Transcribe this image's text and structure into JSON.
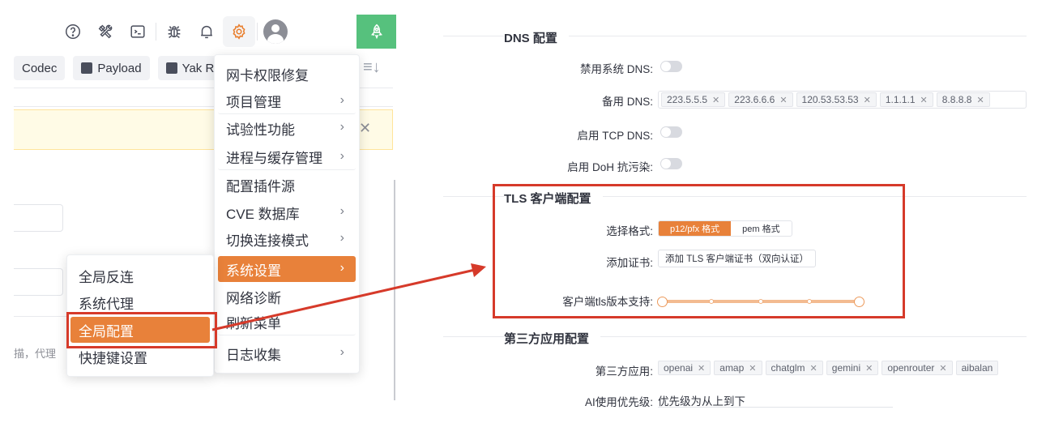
{
  "toolbar": {
    "icons": [
      "help-icon",
      "tools-icon",
      "terminal-icon",
      "bug-icon",
      "bell-icon",
      "gear-icon",
      "user-avatar",
      "rocket-icon"
    ],
    "active_icon": "gear-icon"
  },
  "tabs": [
    {
      "label": "Codec"
    },
    {
      "label": "Payload"
    },
    {
      "label": "Yak R"
    }
  ],
  "partial_text": "描，代理",
  "main_menu": {
    "items": [
      {
        "label": "网卡权限修复",
        "submenu": false
      },
      {
        "label": "项目管理",
        "submenu": true
      },
      {
        "label": "试验性功能",
        "submenu": true
      },
      {
        "label": "进程与缓存管理",
        "submenu": true
      },
      {
        "label": "配置插件源",
        "submenu": false
      },
      {
        "label": "CVE 数据库",
        "submenu": true
      },
      {
        "label": "切换连接模式",
        "submenu": true
      },
      {
        "label": "系统设置",
        "submenu": true,
        "highlighted": true
      },
      {
        "label": "网络诊断",
        "submenu": false
      },
      {
        "label": "刷新菜单",
        "submenu": false
      },
      {
        "label": "日志收集",
        "submenu": true
      }
    ]
  },
  "sub_menu": {
    "items": [
      {
        "label": "全局反连"
      },
      {
        "label": "系统代理"
      },
      {
        "label": "全局配置",
        "highlighted": true
      },
      {
        "label": "快捷键设置"
      }
    ]
  },
  "settings": {
    "dns": {
      "title": "DNS 配置",
      "disable_system_dns_label": "禁用系统 DNS:",
      "backup_dns_label": "备用 DNS:",
      "backup_dns": [
        "223.5.5.5",
        "223.6.6.6",
        "120.53.53.53",
        "1.1.1.1",
        "8.8.8.8"
      ],
      "tcp_dns_label": "启用 TCP DNS:",
      "doh_label": "启用 DoH 抗污染:"
    },
    "tls": {
      "title": "TLS 客户端配置",
      "format_label": "选择格式:",
      "format_options": [
        "p12/pfx 格式",
        "pem 格式"
      ],
      "format_selected": "p12/pfx 格式",
      "cert_label": "添加证书:",
      "cert_button": "添加 TLS 客户端证书（双向认证）",
      "version_label": "客户端tls版本支持:",
      "version_range": [
        0,
        1
      ]
    },
    "third_party": {
      "title": "第三方应用配置",
      "apps_label": "第三方应用:",
      "apps": [
        "openai",
        "amap",
        "chatglm",
        "gemini",
        "openrouter",
        "aibalan"
      ],
      "ai_priority_label": "AI使用优先级:",
      "ai_priority_value": "优先级为从上到下"
    }
  }
}
